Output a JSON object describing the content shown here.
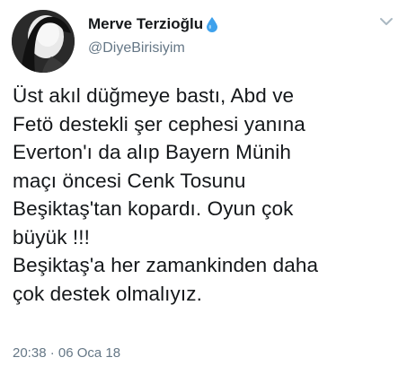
{
  "tweet": {
    "author": {
      "display_name": "Merve Terzioğlu",
      "handle": "@DiyeBirisiyim",
      "badge_icon": "water-drop-icon",
      "avatar_icon": "profile-photo"
    },
    "menu_icon": "chevron-down-icon",
    "text": "Üst akıl düğmeye bastı, Abd ve\nFetö destekli şer cephesi yanına\nEverton'ı da alıp Bayern Münih\nmaçı öncesi Cenk Tosunu\nBeşiktaş'tan kopardı. Oyun çok\nbüyük !!!\nBeşiktaş'a her zamankinden daha\nçok destek olmalıyız.",
    "timestamp": "20:38 · 06 Oca 18",
    "colors": {
      "text": "#14171a",
      "secondary": "#657786",
      "drop": "#3ea1ec"
    }
  }
}
